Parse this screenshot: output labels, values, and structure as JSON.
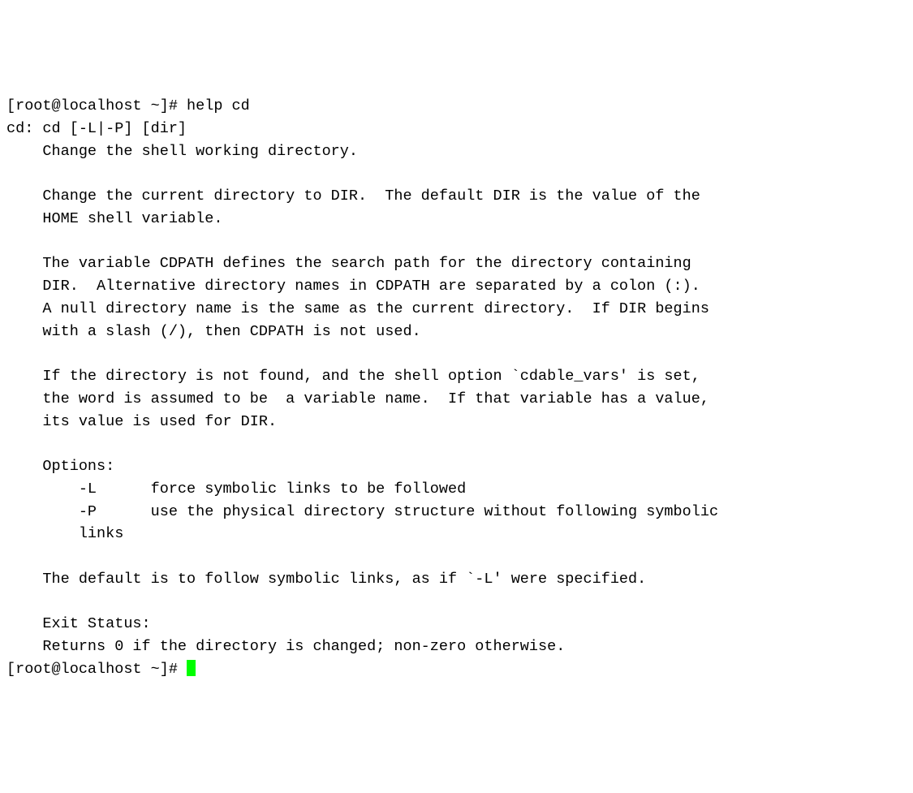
{
  "terminal": {
    "prompt": "[root@localhost ~]# ",
    "command": "help cd",
    "usage": "cd: cd [-L|-P] [dir]",
    "desc_short": "    Change the shell working directory.",
    "blank": "    ",
    "para1_l1": "    Change the current directory to DIR.  The default DIR is the value of the",
    "para1_l2": "    HOME shell variable.",
    "para2_l1": "    The variable CDPATH defines the search path for the directory containing",
    "para2_l2": "    DIR.  Alternative directory names in CDPATH are separated by a colon (:).",
    "para2_l3": "    A null directory name is the same as the current directory.  If DIR begins",
    "para2_l4": "    with a slash (/), then CDPATH is not used.",
    "para3_l1": "    If the directory is not found, and the shell option `cdable_vars' is set,",
    "para3_l2": "    the word is assumed to be  a variable name.  If that variable has a value,",
    "para3_l3": "    its value is used for DIR.",
    "opts_header": "    Options:",
    "opt_l": "        -L      force symbolic links to be followed",
    "opt_p": "        -P      use the physical directory structure without following symbolic",
    "opt_p2": "        links",
    "default_line": "    The default is to follow symbolic links, as if `-L' were specified.",
    "exit_header": "    Exit Status:",
    "exit_desc": "    Returns 0 if the directory is changed; non-zero otherwise."
  }
}
